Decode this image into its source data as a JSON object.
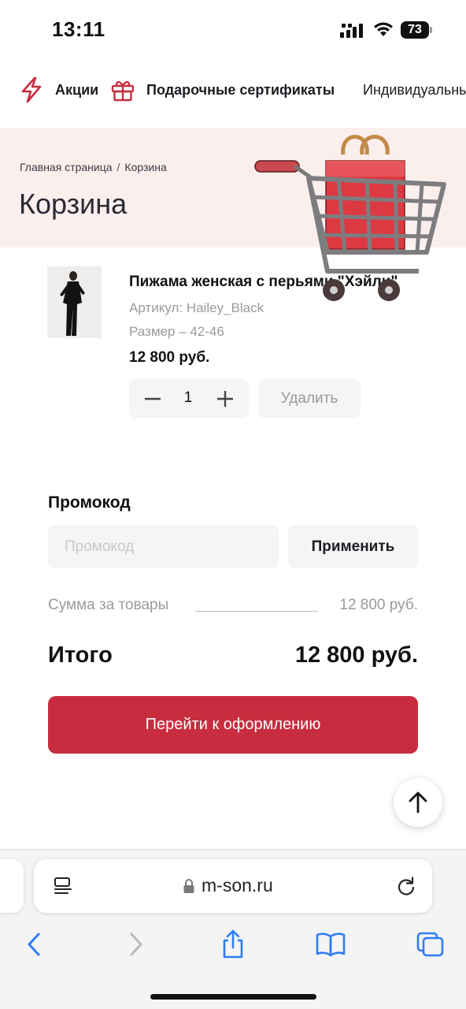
{
  "status_bar": {
    "time": "13:11",
    "battery": "73"
  },
  "top_menu": {
    "promo_label": "Акции",
    "gift_label": "Подарочные сертификаты",
    "individual_label": "Индивидуальный"
  },
  "breadcrumb": {
    "home": "Главная страница",
    "separator": "/",
    "current": "Корзина"
  },
  "page_title": "Корзина",
  "product": {
    "name": "Пижама женская с перьями \"Хэйли\"",
    "sku": "Артикул: Hailey_Black",
    "size": "Размер – 42-46",
    "price": "12 800 руб.",
    "quantity": "1",
    "delete_label": "Удалить"
  },
  "promo": {
    "title": "Промокод",
    "placeholder": "Промокод",
    "value": "",
    "apply_label": "Применить"
  },
  "summary": {
    "sum_label": "Сумма за товары",
    "sum_value": "12 800 руб.",
    "total_label": "Итого",
    "total_value": "12 800 руб."
  },
  "checkout_label": "Перейти к оформлению",
  "browser": {
    "url": "m-son.ru"
  },
  "colors": {
    "accent": "#c72d3f",
    "hero_bg": "#fbefee",
    "field_bg": "#f5f5f6",
    "muted_text": "#9a9a9f"
  },
  "icons": {
    "promo": "lightning-icon",
    "gift": "gift-icon",
    "cart": "shopping-cart-illustration",
    "scroll_top": "arrow-up-icon",
    "reader": "reader-mode-icon",
    "lock": "lock-icon",
    "reload": "reload-icon",
    "back": "chevron-left-icon",
    "forward": "chevron-right-icon",
    "share": "share-icon",
    "bookmarks": "book-icon",
    "tabs": "tabs-icon"
  }
}
